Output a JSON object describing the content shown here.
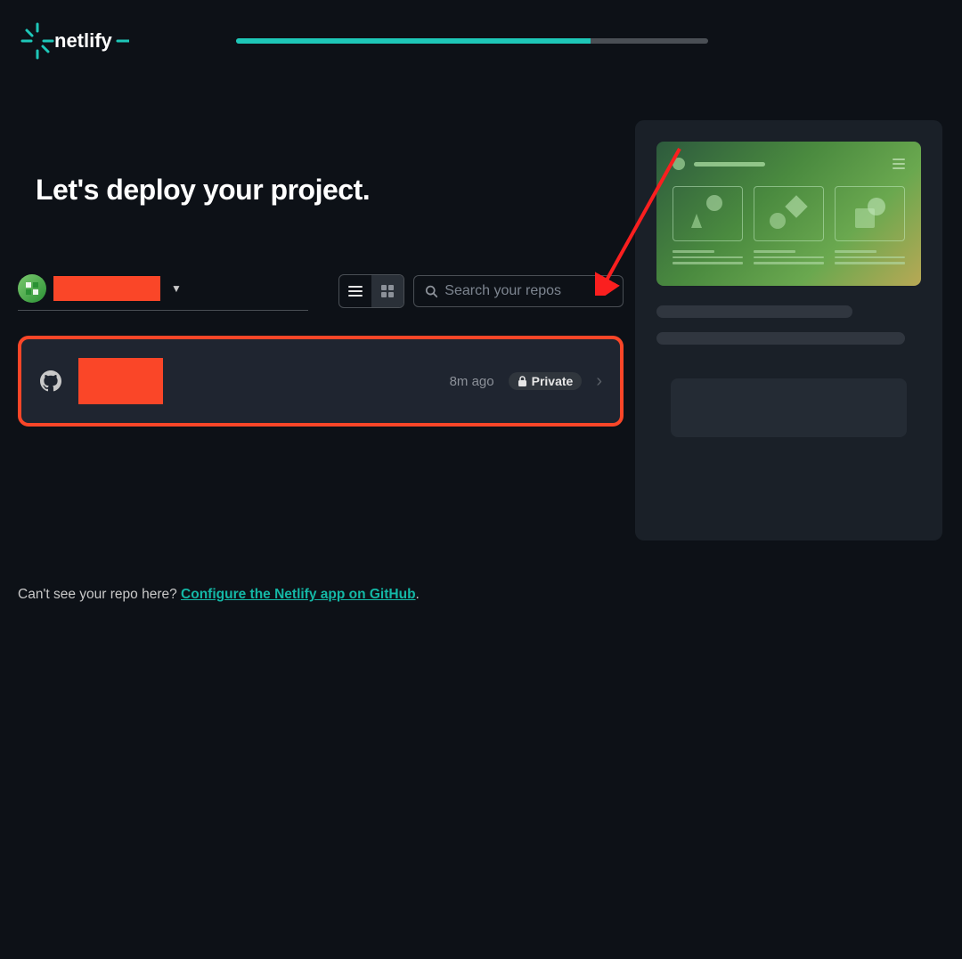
{
  "brand": "netlify",
  "progress_percent": 75,
  "page_title": "Let's deploy your project.",
  "account": {
    "name_redacted": true
  },
  "view": {
    "mode": "list"
  },
  "search": {
    "placeholder": "Search your repos"
  },
  "repos": [
    {
      "name_redacted": true,
      "time": "8m ago",
      "badge": "Private",
      "private": true
    }
  ],
  "help": {
    "prefix": "Can't see your repo here? ",
    "link": "Configure the Netlify app on GitHub",
    "suffix": "."
  },
  "annotation": {
    "highlight_border_color": "#fa4628",
    "has_arrow": true
  }
}
